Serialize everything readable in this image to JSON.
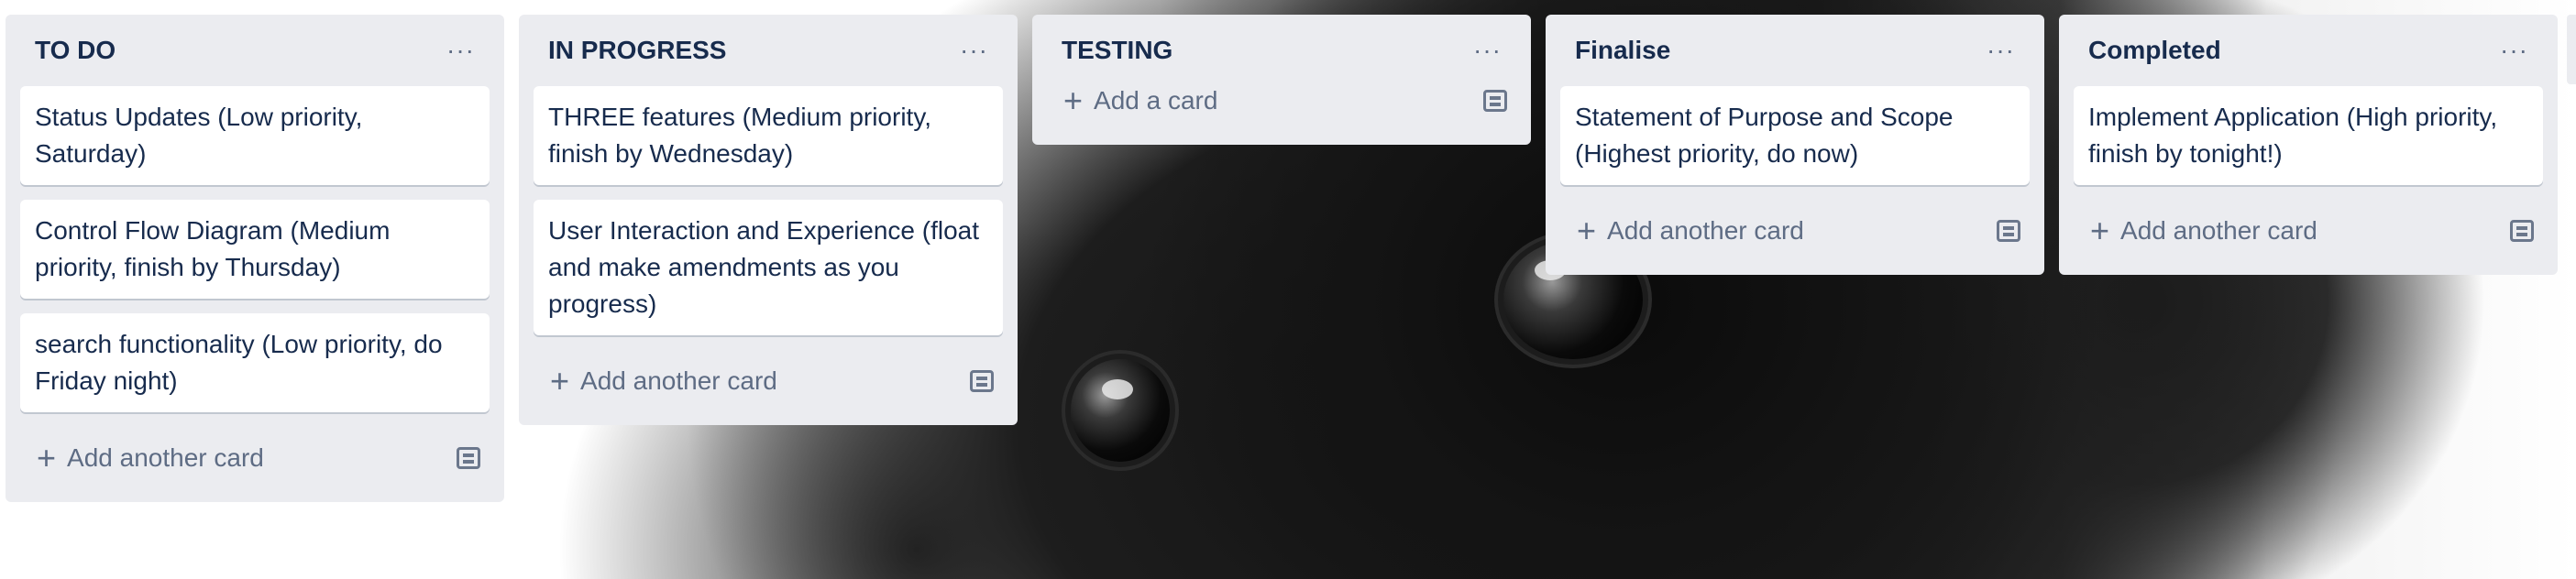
{
  "lists": [
    {
      "title": "TO DO",
      "menu_icon": "more-icon",
      "menu_label": "···",
      "cards": [
        "Status Updates (Low priority, Saturday)",
        "Control Flow Diagram (Medium priority, finish by Thursday)",
        "search functionality (Low priority, do Friday night)"
      ],
      "add_label": "Add another card"
    },
    {
      "title": "IN PROGRESS",
      "menu_icon": "more-icon",
      "menu_label": "···",
      "cards": [
        "THREE features (Medium priority, finish by Wednesday)",
        "User Interaction and Experience (float and make amendments as you progress)"
      ],
      "add_label": "Add another card"
    },
    {
      "title": "TESTING",
      "menu_icon": "more-icon",
      "menu_label": "···",
      "cards": [],
      "add_label": "Add a card"
    },
    {
      "title": "Finalise",
      "menu_icon": "more-icon",
      "menu_label": "···",
      "cards": [
        "Statement of Purpose and Scope (Highest priority, do now)"
      ],
      "add_label": "Add another card"
    },
    {
      "title": "Completed",
      "menu_icon": "more-icon",
      "menu_label": "···",
      "cards": [
        "Implement Application (High priority, finish by tonight!)"
      ],
      "add_label": "Add another card"
    }
  ],
  "icons": {
    "add": "plus-icon",
    "template": "card-template-icon"
  },
  "colors": {
    "list_bg": "#ebecf0",
    "card_bg": "#ffffff",
    "text": "#172b4d",
    "muted": "#5e6c84"
  }
}
